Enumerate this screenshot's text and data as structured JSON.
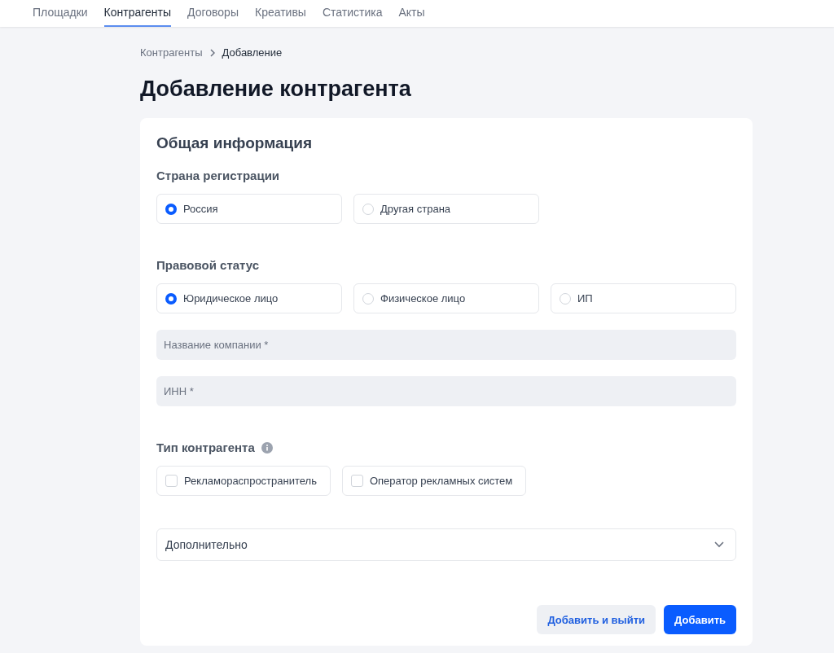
{
  "nav": [
    {
      "label": "Площадки",
      "selected": false
    },
    {
      "label": "Контрагенты",
      "selected": true
    },
    {
      "label": "Договоры",
      "selected": false
    },
    {
      "label": "Креативы",
      "selected": false
    },
    {
      "label": "Статистика",
      "selected": false
    },
    {
      "label": "Акты",
      "selected": false
    }
  ],
  "breadcrumbs": [
    "Контрагенты",
    "Добавление"
  ],
  "page_title": "Добавление контрагента",
  "card": {
    "title": "Общая информация",
    "country": {
      "label": "Страна регистрации",
      "options": [
        {
          "label": "Россия",
          "selected": true
        },
        {
          "label": "Другая страна",
          "selected": false
        }
      ]
    },
    "legal_status": {
      "label": "Правовой статус",
      "options": [
        {
          "label": "Юридическое лицо",
          "selected": true
        },
        {
          "label": "Физическое лицо",
          "selected": false
        },
        {
          "label": "ИП",
          "selected": false
        }
      ]
    },
    "fields": [
      {
        "placeholder": "Название компании *"
      },
      {
        "placeholder": "ИНН *"
      }
    ],
    "type": {
      "label": "Тип контрагента",
      "options": [
        {
          "label": "Рекламораспространитель",
          "checked": false
        },
        {
          "label": "Оператор рекламных систем",
          "checked": false
        }
      ]
    },
    "additional": {
      "label": "Дополнительно",
      "expanded": false
    },
    "buttons": [
      {
        "label": "Добавить и выйти",
        "kind": "secondary"
      },
      {
        "label": "Добавить",
        "kind": "primary"
      }
    ]
  }
}
